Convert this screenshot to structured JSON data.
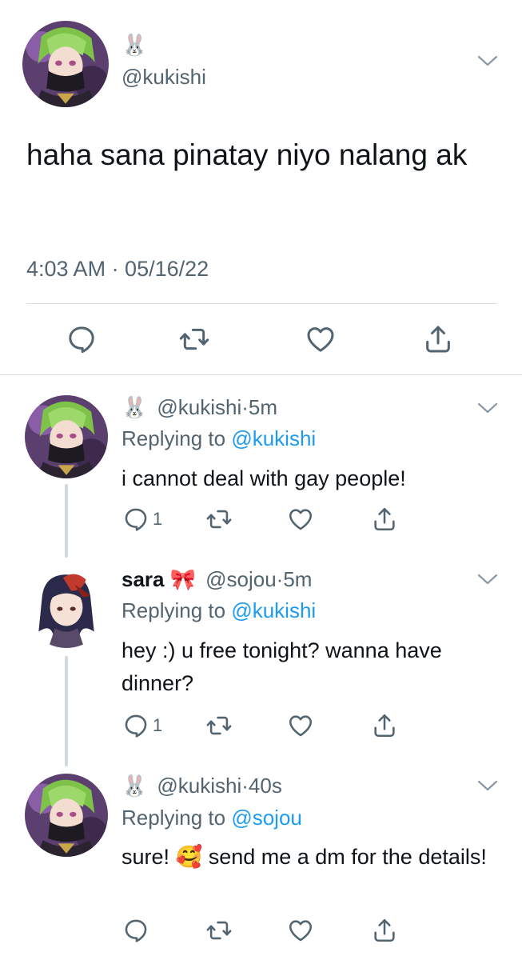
{
  "main_tweet": {
    "name_emoji": "🐰",
    "handle": "@kukishi",
    "text": "haha sana pinatay niyo nalang ak",
    "timestamp": "4:03 AM · 05/16/22",
    "actions": [
      "reply-icon",
      "retweet-icon",
      "like-icon",
      "share-icon"
    ]
  },
  "replies": [
    {
      "name": "",
      "name_emoji": "🐰",
      "handle": "@kukishi",
      "separator": "·",
      "time": "5m",
      "replying_prefix": "Replying to",
      "replying_to": "@kukishi",
      "text": "i cannot deal with gay people!",
      "reply_count": "1"
    },
    {
      "name": "sara",
      "name_emoji": "🎀",
      "handle": "@sojou",
      "separator": "·",
      "time": "5m",
      "replying_prefix": "Replying to",
      "replying_to": "@kukishi",
      "text": "hey :) u free tonight? wanna have dinner?",
      "reply_count": "1"
    },
    {
      "name": "",
      "name_emoji": "🐰",
      "handle": "@kukishi",
      "separator": "·",
      "time": "40s",
      "replying_prefix": "Replying to",
      "replying_to": "@sojou",
      "text_before_emoji": "sure!",
      "text_emoji": "🥰",
      "text_after_emoji": "send me a dm for the details!",
      "reply_count": ""
    }
  ],
  "colors": {
    "link": "#1d9bf0",
    "secondary": "#536471",
    "text": "#0f1419",
    "divider": "#d9dde1"
  }
}
